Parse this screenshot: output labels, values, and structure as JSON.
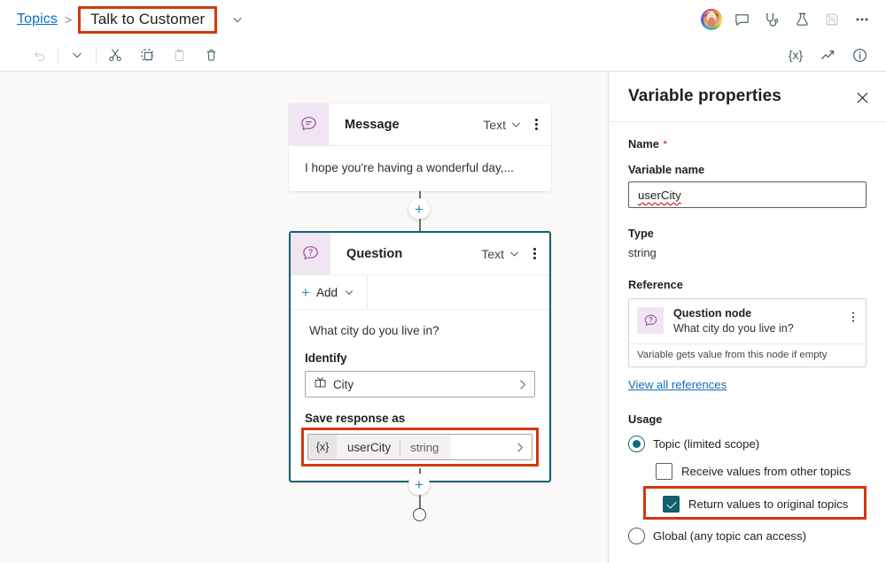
{
  "breadcrumb": {
    "root_label": "Topics",
    "separator": ">",
    "current_label": "Talk to Customer",
    "chevron_icon": "chevron-down-icon"
  },
  "topbar_right": {
    "avatar_icon": "user-avatar",
    "icons": [
      {
        "name": "comment-icon",
        "label": "Comments"
      },
      {
        "name": "stethoscope-icon",
        "label": "Diagnostics"
      },
      {
        "name": "flask-icon",
        "label": "Test bot"
      },
      {
        "name": "save-icon",
        "label": "Save",
        "disabled": true
      },
      {
        "name": "more-icon",
        "label": "More"
      }
    ]
  },
  "toolbar": {
    "left_icons": [
      {
        "name": "undo-icon",
        "label": "Undo",
        "disabled": true
      },
      {
        "name": "chevron-down-icon",
        "label": "History"
      },
      {
        "name": "cut-icon",
        "label": "Cut"
      },
      {
        "name": "copy-selection-icon",
        "label": "Copy"
      },
      {
        "name": "paste-icon",
        "label": "Paste",
        "disabled": true
      },
      {
        "name": "delete-icon",
        "label": "Delete"
      }
    ],
    "right_icons": [
      {
        "name": "variables-icon",
        "label": "{x}"
      },
      {
        "name": "analytics-icon",
        "label": "Analytics"
      },
      {
        "name": "info-icon",
        "label": "Details"
      }
    ],
    "variables_glyph": "{x}"
  },
  "canvas": {
    "message_node": {
      "icon": "message-bubble-icon",
      "title": "Message",
      "type_label": "Text",
      "type_chevron": "chevron-down-icon",
      "kebab": "more-vertical-icon",
      "body": "I hope you're having a wonderful day,..."
    },
    "question_node": {
      "icon": "question-bubble-icon",
      "title": "Question",
      "type_label": "Text",
      "type_chevron": "chevron-down-icon",
      "kebab": "more-vertical-icon",
      "add_label": "Add",
      "add_plus": "+",
      "prompt": "What city do you live in?",
      "identify_label": "Identify",
      "identify_value": "City",
      "identify_icon": "entity-icon",
      "save_label": "Save response as",
      "variable_glyph": "{x}",
      "variable_name": "userCity",
      "variable_type": "string",
      "chevron_icon": "chevron-right-icon",
      "selected_border_color": "#13606e",
      "highlight_color": "#d2390d"
    },
    "connectors": {
      "plus_glyph": "+",
      "add_node_label": "Add node",
      "end_node_label": "End"
    },
    "background_color": "#faf9f8"
  },
  "panel": {
    "title": "Variable properties",
    "close_icon": "close-icon",
    "name_label": "Name",
    "required_marker": "*",
    "variable_name_label": "Variable name",
    "variable_name_value": "userCity",
    "type_label": "Type",
    "type_value": "string",
    "reference_label": "Reference",
    "reference_card": {
      "icon": "question-bubble-icon",
      "title": "Question node",
      "subtitle": "What city do you live in?",
      "footer": "Variable gets value from this node if empty",
      "kebab": "more-vertical-icon"
    },
    "view_all_references": "View all references",
    "usage_label": "Usage",
    "options": [
      {
        "name": "topic-limited-scope",
        "label": "Topic (limited scope)",
        "type": "radio",
        "checked": true
      },
      {
        "name": "receive-values-from-other-topics",
        "label": "Receive values from other topics",
        "type": "checkbox",
        "checked": false,
        "highlighted": false
      },
      {
        "name": "return-values-to-original-topics",
        "label": "Return values to original topics",
        "type": "checkbox",
        "checked": true,
        "highlighted": true
      },
      {
        "name": "global-any-topic-can-access",
        "label": "Global (any topic can access)",
        "type": "radio",
        "checked": false
      }
    ],
    "accent_color": "#13606e",
    "highlight_color": "#d2390d"
  }
}
